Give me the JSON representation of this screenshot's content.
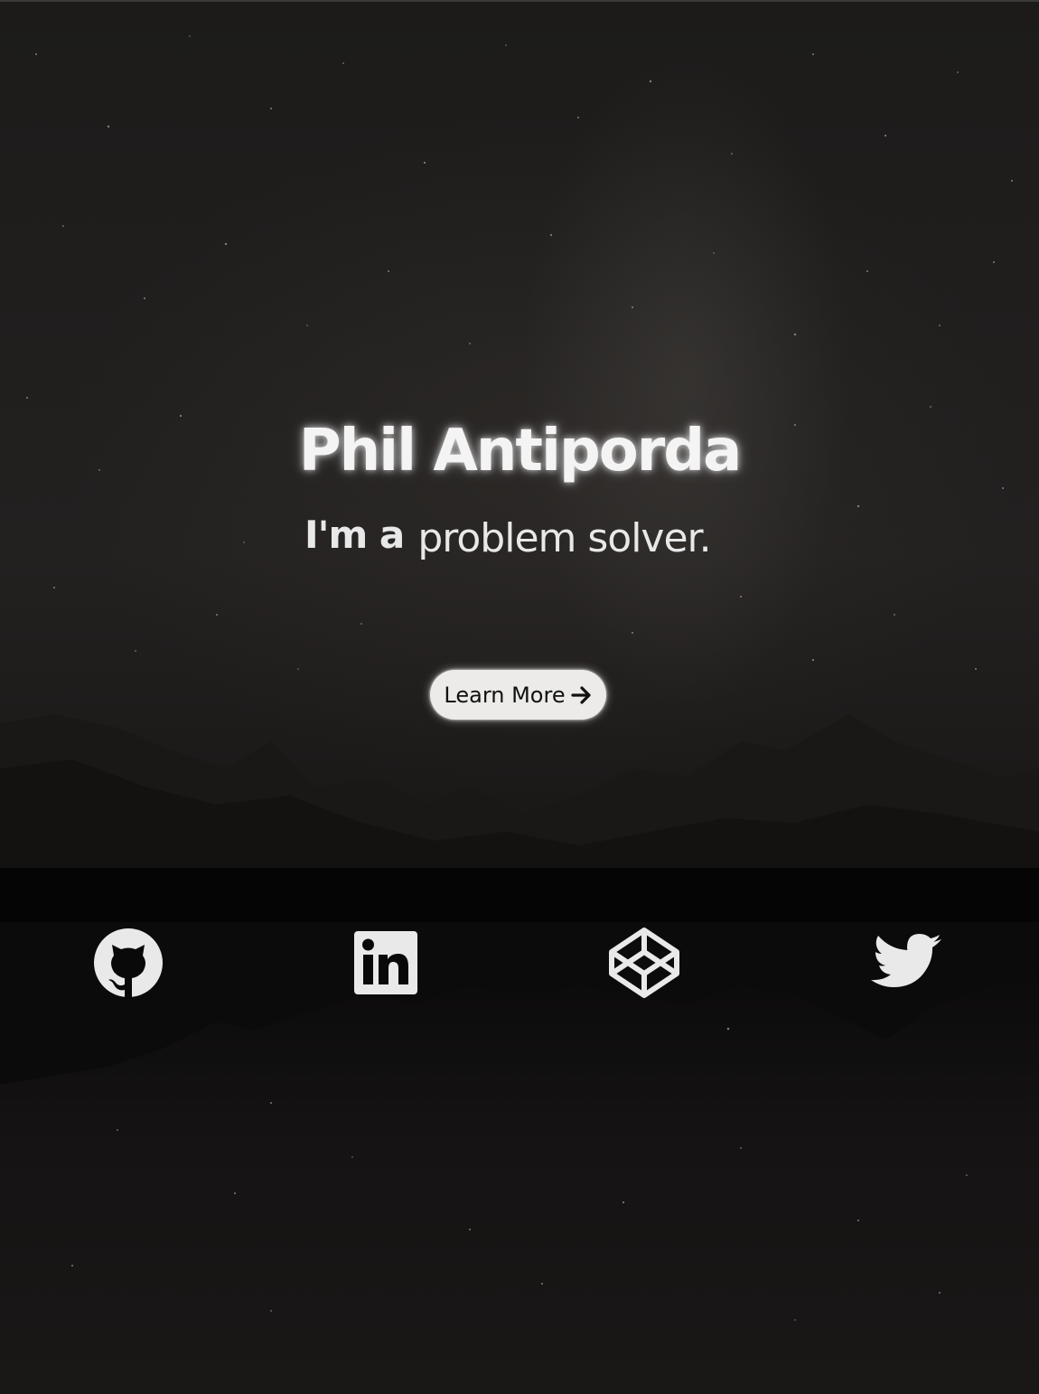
{
  "hero": {
    "name": "Phil Antiporda",
    "tagline_prefix": "I'm a",
    "tagline_role": "problem solver."
  },
  "cta": {
    "label": "Learn More",
    "icon": "arrow-right-icon"
  },
  "social_links": [
    {
      "icon": "github-icon"
    },
    {
      "icon": "linkedin-icon"
    },
    {
      "icon": "codepen-icon"
    },
    {
      "icon": "twitter-icon"
    }
  ],
  "colors": {
    "background": "#1c1b1a",
    "text": "#f4f4f4",
    "button_bg": "#ecebe9",
    "button_text": "#111111"
  }
}
